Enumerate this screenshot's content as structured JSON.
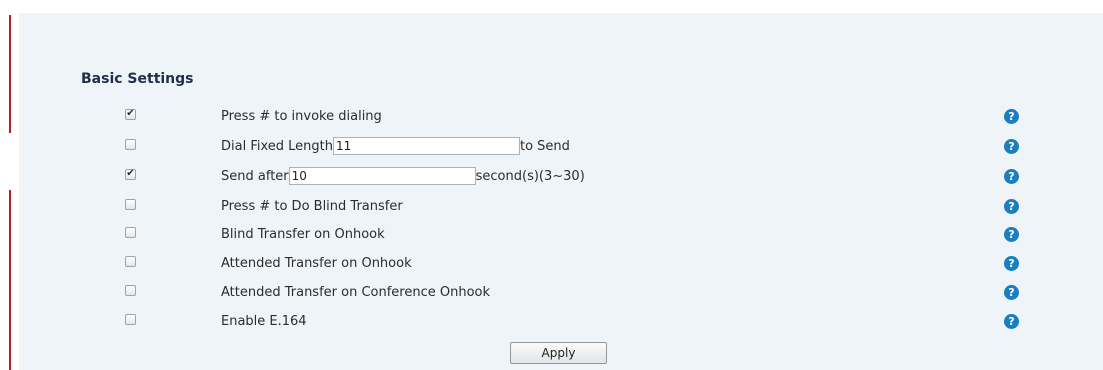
{
  "section": {
    "title": "Basic Settings"
  },
  "rows": [
    {
      "label": "Press # to invoke dialing",
      "checked": true
    },
    {
      "label_before": "Dial Fixed Length",
      "input_value": "11",
      "label_after": "to Send",
      "checked": false
    },
    {
      "label_before": "Send after",
      "input_value": "10",
      "label_after": "second(s)(3~30)",
      "checked": true
    },
    {
      "label": "Press # to Do Blind Transfer",
      "checked": false
    },
    {
      "label": "Blind Transfer on Onhook",
      "checked": false
    },
    {
      "label": "Attended Transfer on Onhook",
      "checked": false
    },
    {
      "label": "Attended Transfer on Conference Onhook",
      "checked": false
    },
    {
      "label": "Enable E.164",
      "checked": false
    }
  ],
  "icons": {
    "help": "help-icon",
    "check": "checkmark-icon"
  },
  "help_glyph": "?",
  "check_glyph": "✔",
  "apply_label": "Apply",
  "colors": {
    "panel_background": "#eef4f8",
    "accent_red": "#b0232a",
    "help_icon": "#1a7fc1",
    "title_text": "#1f2f4a"
  }
}
